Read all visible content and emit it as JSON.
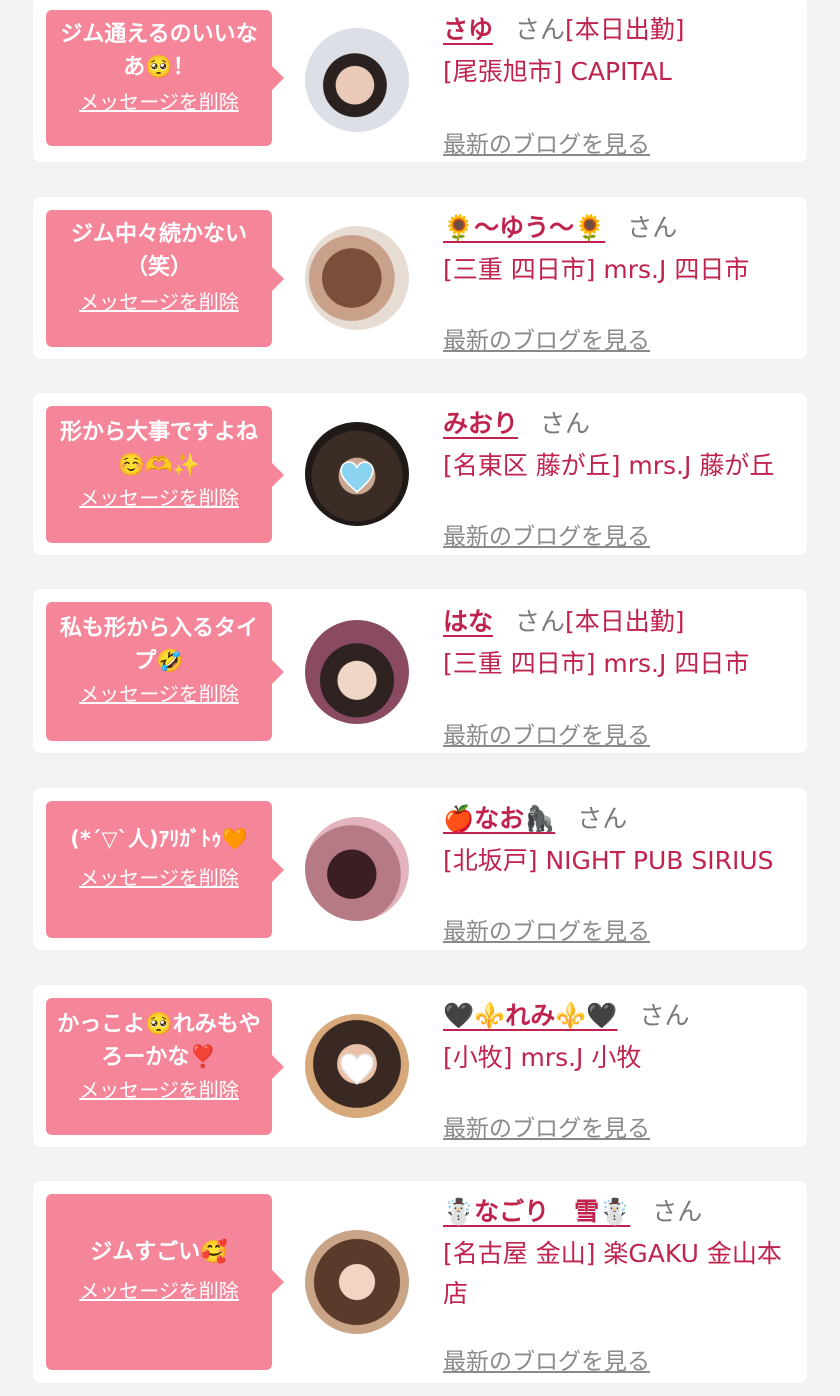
{
  "delete_label": "メッセージを削除",
  "blog_label": "最新のブログを見る",
  "san_label": "さん",
  "colors": {
    "bubble": "#f5869a",
    "accent": "#c0244e",
    "muted": "#8a8a8a",
    "page_bg": "#f2f2f2"
  },
  "entries": [
    {
      "message": "ジム通えるのいいなあ🥺！",
      "name": "さゆ",
      "status": "[本日出勤]",
      "shop": "[尾張旭市] CAPITAL"
    },
    {
      "message": "ジム中々続かない（笑）",
      "name": "🌻〜ゆう〜🌻",
      "status": "",
      "shop": "[三重 四日市] mrs.J 四日市"
    },
    {
      "message": "形から大事ですよね☺️🫶✨",
      "name": "みおり",
      "status": "",
      "shop": "[名東区 藤が丘] mrs.J 藤が丘"
    },
    {
      "message": "私も形から入るタイプ🤣",
      "name": "はな",
      "status": "[本日出勤]",
      "shop": "[三重 四日市] mrs.J 四日市"
    },
    {
      "message": "(*´▽`人)ｱﾘｶﾞﾄｩ🧡",
      "name": "🍎なお🦍",
      "status": "",
      "shop": "[北坂戸] NIGHT PUB SIRIUS"
    },
    {
      "message": "かっこよ🥺れみもやろーかな❣️",
      "name": "🖤⚜️れみ⚜️🖤",
      "status": "",
      "shop": "[小牧] mrs.J 小牧"
    },
    {
      "message": "ジムすごい🥰",
      "name": "☃️なごり　雪☃️",
      "status": "",
      "shop": "[名古屋 金山] 楽GAKU 金山本店"
    }
  ]
}
